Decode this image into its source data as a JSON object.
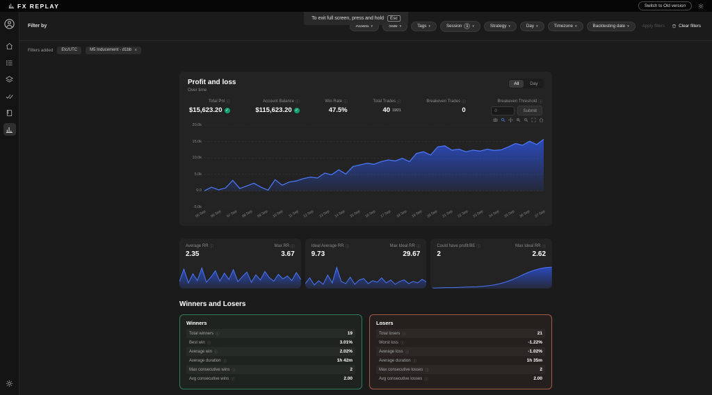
{
  "colors": {
    "accent_blue": "#4a76f7",
    "chart_fill": "#2d54e0",
    "success_green": "#12a06c",
    "winners_border": "#2e7d5b",
    "losers_border": "#a85a49",
    "background": "#1b1b1b",
    "card_background": "#232323"
  },
  "icons": {
    "theme": "sun-icon",
    "clear_filters": "trash-icon",
    "info": "info-circle-icon",
    "success": "check-circle-icon",
    "dropdown": "chevron-down-icon",
    "remove_tag": "close-x-icon",
    "sidebar": [
      "user-icon",
      "home-icon",
      "list-icon",
      "layers-icon",
      "double-check-icon",
      "book-icon",
      "bar-chart-icon",
      "gear-icon"
    ],
    "chart_toolbar": [
      "camera-icon",
      "zoom-icon",
      "pan-icon",
      "zoom-in-icon",
      "zoom-out-icon",
      "autoscale-icon",
      "home-icon"
    ]
  },
  "topbar": {
    "logo_text": "FX REPLAY",
    "switch_button": "Switch to Old version"
  },
  "banner": {
    "text": "To exit full screen, press and hold",
    "key": "Esc"
  },
  "filterbar": {
    "label": "Filter by",
    "dropdowns": [
      "Assets",
      "Side",
      "Tags",
      "Session",
      "Strategy",
      "Day",
      "Timezone",
      "Backtesting date"
    ],
    "session_count": "1",
    "apply_button": "Apply filters",
    "clear_button": "Clear filters"
  },
  "filters_added": {
    "label": "Filters added",
    "tags": [
      "Etc/UTC",
      "M5 Inducement - d1bb"
    ]
  },
  "pnl_card": {
    "title": "Profit and loss",
    "subtitle": "Over time",
    "toggle_all": "All",
    "toggle_day": "Day",
    "stats": [
      {
        "label": "Total Pnl",
        "value": "$15,623.20"
      },
      {
        "label": "Account Balance",
        "value": "$115,623.20"
      },
      {
        "label": "Win Rate",
        "value": "47.5%"
      },
      {
        "label": "Total Trades",
        "value": "40",
        "sup": "19/21"
      },
      {
        "label": "Breakeven Trades",
        "value": "0"
      }
    ],
    "threshold": {
      "label": "Breakeven Threshold",
      "placeholder": "0",
      "submit_label": "Submit"
    }
  },
  "mini_cards": [
    {
      "left_label": "Average RR",
      "left_value": "2.35",
      "right_label": "Max RR",
      "right_value": "3.67"
    },
    {
      "left_label": "Ideal Average RR",
      "left_value": "9.73",
      "right_label": "Max Ideal RR",
      "right_value": "29.67"
    },
    {
      "left_label": "Could have profit/BE",
      "left_value": "2",
      "right_label": "Max Ideal RR",
      "right_value": "2.62"
    }
  ],
  "winners_losers": {
    "heading": "Winners and Losers",
    "winners": {
      "title": "Winners",
      "rows": [
        {
          "label": "Total winners",
          "value": "19"
        },
        {
          "label": "Best win",
          "value": "3.01%"
        },
        {
          "label": "Average win",
          "value": "2.02%"
        },
        {
          "label": "Average duration",
          "value": "1h 42m"
        },
        {
          "label": "Max consecutive wins",
          "value": "2"
        },
        {
          "label": "Avg consecutive wins",
          "value": "2.00"
        }
      ]
    },
    "losers": {
      "title": "Losers",
      "rows": [
        {
          "label": "Total losers",
          "value": "21"
        },
        {
          "label": "Worst loss",
          "value": "-1.22%"
        },
        {
          "label": "Average loss",
          "value": "-1.02%"
        },
        {
          "label": "Average duration",
          "value": "1h 35m"
        },
        {
          "label": "Max consecutive losses",
          "value": "2"
        },
        {
          "label": "Avg consecutive losses",
          "value": "2.00"
        }
      ]
    }
  },
  "chart_data": {
    "equity": {
      "type": "area",
      "title": "Profit and loss",
      "subtitle": "Over time",
      "ylim": [
        -5000,
        20000
      ],
      "y_ticks": [
        "20.0k",
        "15.0k",
        "10.0k",
        "5.0k",
        "0.0",
        "-5.0k"
      ],
      "y_tick_values": [
        20000,
        15000,
        10000,
        5000,
        0,
        -5000
      ],
      "x_labels": [
        "05 Sep",
        "06 Sep",
        "07 Sep",
        "08 Sep",
        "09 Sep",
        "10 Sep",
        "11 Sep",
        "12 Sep",
        "13 Sep",
        "14 Sep",
        "15 Sep",
        "16 Sep",
        "17 Sep",
        "18 Sep",
        "19 Sep",
        "20 Sep",
        "21 Sep",
        "22 Sep",
        "23 Sep",
        "24 Sep",
        "25 Sep",
        "26 Sep",
        "27 Sep"
      ],
      "values": [
        0,
        1100,
        300,
        900,
        3200,
        700,
        1500,
        2300,
        1100,
        200,
        3400,
        1700,
        2700,
        3000,
        3700,
        4200,
        3900,
        5400,
        4900,
        6400,
        5100,
        7400,
        7900,
        8400,
        8100,
        8900,
        9400,
        9100,
        9900,
        8900,
        11400,
        11900,
        10900,
        13400,
        13700,
        12400,
        12700,
        11900,
        12400,
        12100,
        12700,
        12300,
        12500,
        13400,
        14400,
        13900,
        15100,
        14100,
        15700
      ]
    },
    "average_rr": {
      "type": "area",
      "ylim": [
        0,
        4
      ],
      "values": [
        1.2,
        3.4,
        1.0,
        2.6,
        1.4,
        3.6,
        1.1,
        2.0,
        3.1,
        1.3,
        2.7,
        1.6,
        3.3,
        1.2,
        2.1,
        2.9,
        1.1,
        2.4,
        1.5,
        3.0,
        1.9,
        1.3,
        2.5,
        1.7,
        2.2,
        1.4,
        2.8,
        1.6
      ]
    },
    "ideal_rr": {
      "type": "area",
      "ylim": [
        0,
        32
      ],
      "values": [
        7,
        15,
        5,
        11,
        6,
        19,
        8,
        29.7,
        10,
        7,
        16,
        6,
        12,
        14,
        7,
        11,
        9,
        15,
        8,
        12,
        6,
        10,
        12,
        7,
        10,
        8,
        13,
        9
      ]
    },
    "could_profit": {
      "type": "area",
      "ylim": [
        0,
        2.8
      ],
      "values": [
        0.08,
        0.08,
        0.1,
        0.12,
        0.12,
        0.15,
        0.18,
        0.2,
        0.22,
        0.28,
        0.35,
        0.45,
        0.6,
        0.8,
        1.05,
        1.35,
        1.7,
        2.0,
        2.25,
        2.45,
        2.58,
        2.62
      ]
    }
  }
}
